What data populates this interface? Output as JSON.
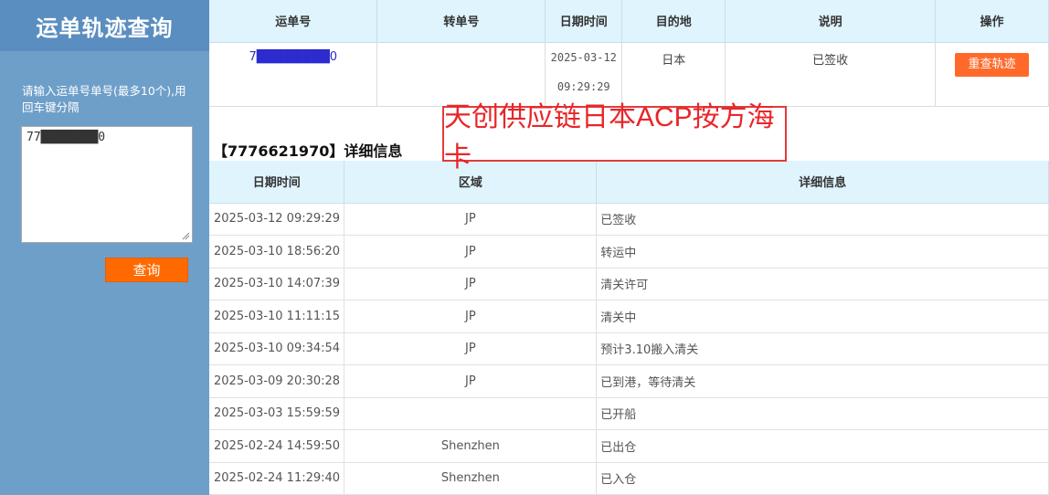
{
  "sidebar": {
    "title": "运单轨迹查询",
    "hint": "请输入运单号单号(最多10个),用回车键分隔",
    "textarea_value": "77████████0",
    "query_label": "查询"
  },
  "summary": {
    "headers": [
      "运单号",
      "转单号",
      "日期时间",
      "目的地",
      "说明",
      "操作"
    ],
    "row": {
      "waybill": "7████████0",
      "transfer": "",
      "date": "2025-03-12",
      "time": "09:29:29",
      "destination": "日本",
      "note": "已签收",
      "action_label": "重查轨迹"
    }
  },
  "banner": "天创供应链日本ACP按方海卡",
  "detail_title": "【7776621970】详细信息",
  "details": {
    "headers": [
      "日期时间",
      "区域",
      "详细信息"
    ],
    "rows": [
      {
        "time": "2025-03-12 09:29:29",
        "region": "JP",
        "info": "已签收"
      },
      {
        "time": "2025-03-10 18:56:20",
        "region": "JP",
        "info": "转运中"
      },
      {
        "time": "2025-03-10 14:07:39",
        "region": "JP",
        "info": "清关许可"
      },
      {
        "time": "2025-03-10 11:11:15",
        "region": "JP",
        "info": "清关中"
      },
      {
        "time": "2025-03-10 09:34:54",
        "region": "JP",
        "info": "预计3.10搬入清关"
      },
      {
        "time": "2025-03-09 20:30:28",
        "region": "JP",
        "info": "已到港，等待清关"
      },
      {
        "time": "2025-03-03 15:59:59",
        "region": "",
        "info": "已开船"
      },
      {
        "time": "2025-02-24 14:59:50",
        "region": "Shenzhen",
        "info": "已出仓"
      },
      {
        "time": "2025-02-24 11:29:40",
        "region": "Shenzhen",
        "info": "已入仓"
      }
    ]
  },
  "colors": {
    "sidebar_bg": "#6e9fc9",
    "sidebar_head_bg": "#5b8ec0",
    "header_bg": "#dff4fd",
    "accent_orange": "#ff6a00",
    "banner_red": "#e8262a",
    "waybill_link": "#2b2bd0"
  }
}
